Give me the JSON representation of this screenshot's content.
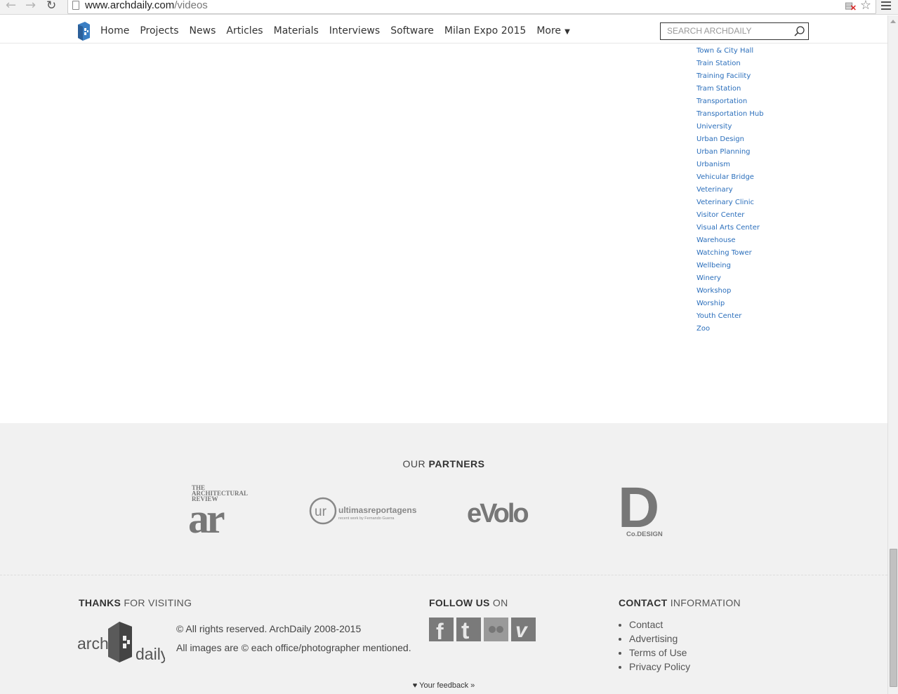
{
  "browser": {
    "url_host": "www.archdaily.com",
    "url_path": "/videos"
  },
  "header": {
    "nav": [
      "Home",
      "Projects",
      "News",
      "Articles",
      "Materials",
      "Interviews",
      "Software",
      "Milan Expo 2015",
      "More"
    ],
    "search_placeholder": "SEARCH ARCHDAILY"
  },
  "categories": [
    "Town & City Hall",
    "Train Station",
    "Training Facility",
    "Tram Station",
    "Transportation",
    "Transportation Hub",
    "University",
    "Urban Design",
    "Urban Planning",
    "Urbanism",
    "Vehicular Bridge",
    "Veterinary",
    "Veterinary Clinic",
    "Visitor Center",
    "Visual Arts Center",
    "Warehouse",
    "Watching Tower",
    "Wellbeing",
    "Winery",
    "Workshop",
    "Worship",
    "Youth Center",
    "Zoo"
  ],
  "footer": {
    "partners_title_a": "OUR ",
    "partners_title_b": "PARTNERS",
    "partners": {
      "ar_line1": "THE",
      "ar_line2": "ARCHITECTURAL",
      "ar_line3": "REVIEW",
      "ar_mark": "ar",
      "ur_mark": "ur",
      "ur_name": "ultimasreportagens",
      "ur_sub": "recent work by Fernando Guerra",
      "evolo": "eVolo",
      "codesign_mark": "D",
      "codesign": "Co.DESIGN"
    },
    "thanks_a": "THANKS",
    "thanks_b": " FOR VISITING",
    "logo_left": "arch",
    "logo_right": "daily",
    "copyright_1": "© All rights reserved. ArchDaily 2008-2015",
    "copyright_2": "All images are © each office/photographer mentioned.",
    "follow_a": "FOLLOW US",
    "follow_b": " ON",
    "social": [
      "facebook",
      "twitter",
      "flickr",
      "vimeo"
    ],
    "social_glyphs": [
      "f",
      "t",
      "●●",
      "v"
    ],
    "contact_a": "CONTACT",
    "contact_b": " INFORMATION",
    "contact_links": [
      "Contact",
      "Advertising",
      "Terms of Use",
      "Privacy Policy"
    ],
    "feedback": "♥ Your feedback »"
  },
  "colors": {
    "link": "#2a6ebb",
    "footer_bg": "#f1f1f1",
    "logo_blue": "#3b7fc4"
  }
}
